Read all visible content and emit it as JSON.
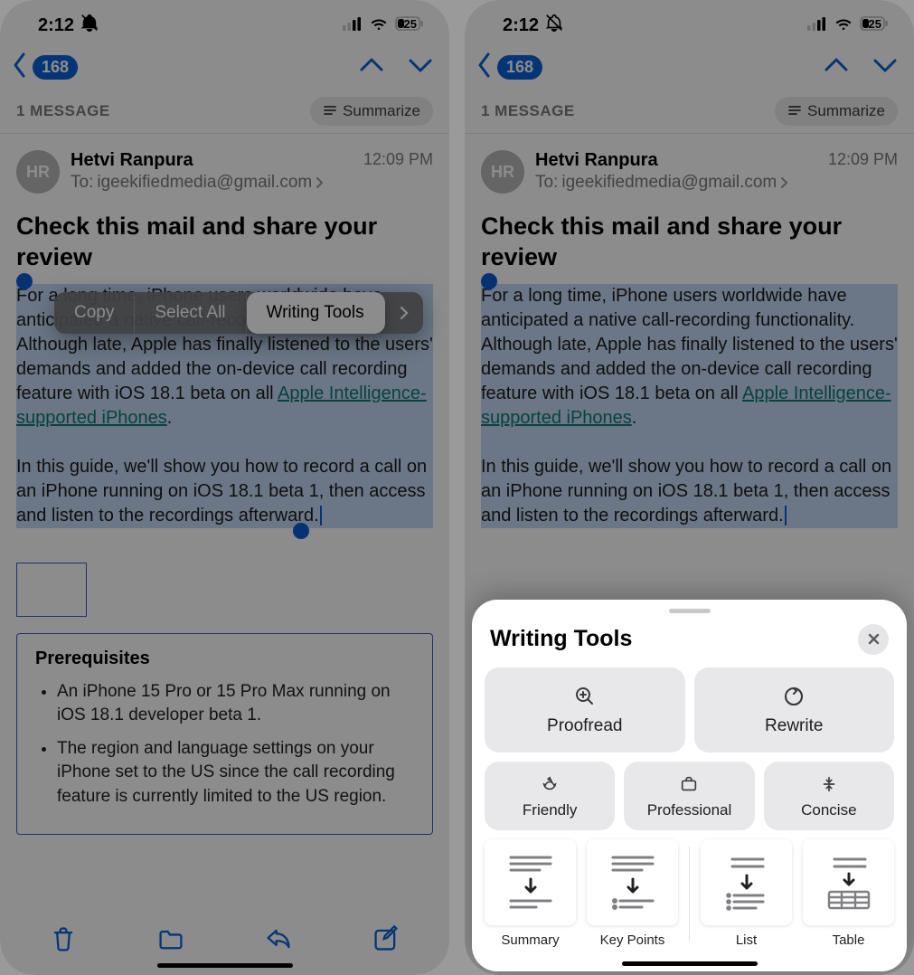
{
  "status": {
    "time": "2:12",
    "battery": "25"
  },
  "nav": {
    "back_badge": "168"
  },
  "header": {
    "message_count": "1 MESSAGE",
    "summarize": "Summarize"
  },
  "sender": {
    "initials": "HR",
    "name": "Hetvi Ranpura",
    "to_label": "To:",
    "email": "igeekifiedmedia@gmail.com",
    "time": "12:09 PM"
  },
  "subject": "Check this mail and share your review",
  "body": {
    "p1_a": "For a long time, iPhone users worldwide have anticipated a native call-recording functionality. Although late, Apple has finally listened to the users' demands and added the on-device call recording feature with iOS 18.1 beta on all ",
    "link": "Apple Intelligence-supported iPhones",
    "p1_b": ".",
    "p2": "In this guide, we'll show you how to record a call on an iPhone running on iOS 18.1 beta 1, then access and listen to the recordings afterward."
  },
  "prereq": {
    "title": "Prerequisites",
    "items": [
      "An iPhone 15 Pro or 15 Pro Max running on iOS 18.1 developer beta 1.",
      "The region and language settings on your iPhone set to the US since the call recording feature is currently limited to the US region."
    ]
  },
  "ctx": {
    "copy": "Copy",
    "select_all": "Select All",
    "writing_tools": "Writing Tools"
  },
  "sheet": {
    "title": "Writing Tools",
    "proofread": "Proofread",
    "rewrite": "Rewrite",
    "friendly": "Friendly",
    "professional": "Professional",
    "concise": "Concise",
    "summary": "Summary",
    "key_points": "Key Points",
    "list": "List",
    "table": "Table"
  }
}
